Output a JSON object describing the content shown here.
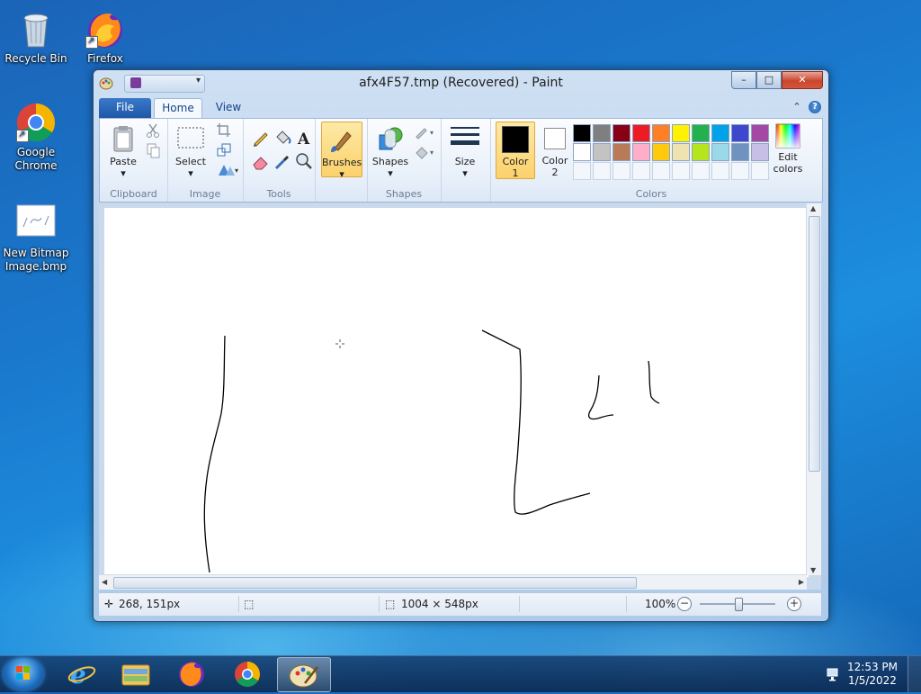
{
  "desktop": {
    "icons": [
      {
        "label": "Recycle Bin",
        "icon": "recycle-bin-icon"
      },
      {
        "label": "Firefox",
        "icon": "firefox-icon"
      },
      {
        "label": "Google Chrome",
        "icon": "chrome-icon"
      },
      {
        "label": "New Bitmap Image.bmp",
        "icon": "bitmap-file-icon"
      }
    ]
  },
  "window": {
    "title": "afx4F57.tmp (Recovered) - Paint",
    "controls": {
      "minimize": "–",
      "maximize": "□",
      "close": "✕"
    }
  },
  "ribbon": {
    "tabs": {
      "file": "File",
      "home": "Home",
      "view": "View"
    },
    "groups": {
      "clipboard": {
        "label": "Clipboard",
        "paste": "Paste"
      },
      "image": {
        "label": "Image",
        "select": "Select"
      },
      "tools": {
        "label": "Tools"
      },
      "brushes": {
        "label": "Brushes"
      },
      "shapes": {
        "label": "Shapes",
        "shapes_btn": "Shapes"
      },
      "size": {
        "label": "Size"
      },
      "colors": {
        "label": "Colors",
        "color1": "Color 1",
        "color2": "Color 2",
        "edit": "Edit colors"
      }
    },
    "palette_row1": [
      "#000000",
      "#7f7f7f",
      "#880015",
      "#ed1c24",
      "#ff7f27",
      "#fff200",
      "#22b14c",
      "#00a2e8",
      "#3f48cc",
      "#a349a4"
    ],
    "palette_row2": [
      "#ffffff",
      "#c3c3c3",
      "#b97a57",
      "#ffaec9",
      "#ffc90e",
      "#efe4b0",
      "#b5e61d",
      "#99d9ea",
      "#7092be",
      "#c8bfe7"
    ],
    "color1_value": "#000000",
    "color2_value": "#ffffff"
  },
  "status": {
    "cursor_pos": "268, 151px",
    "canvas_size": "1004 × 548px",
    "zoom": "100%",
    "zoom_minus": "−",
    "zoom_plus": "+"
  },
  "taskbar": {
    "items": [
      "start-orb-icon",
      "ie-icon",
      "explorer-icon",
      "firefox-icon",
      "chrome-icon",
      "paint-icon"
    ],
    "active": "paint-icon",
    "time": "12:53 PM",
    "date": "1/5/2022"
  }
}
